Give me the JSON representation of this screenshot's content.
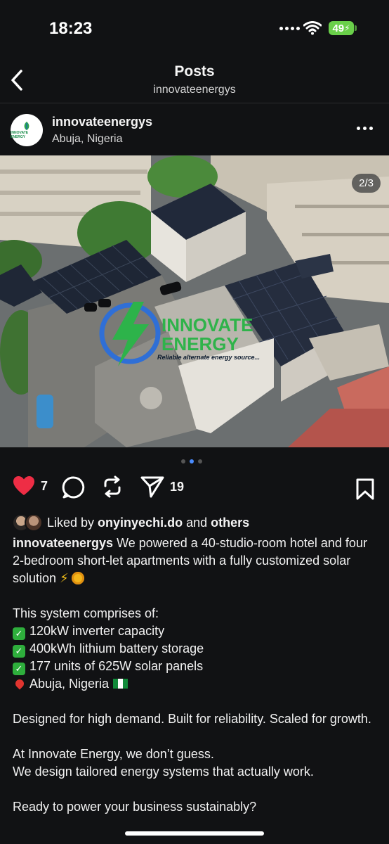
{
  "status": {
    "time": "18:23",
    "battery": "49"
  },
  "nav": {
    "title": "Posts",
    "subtitle": "innovateenergys"
  },
  "post": {
    "username": "innovateenergys",
    "location": "Abuja, Nigeria",
    "avatar_text": "INNOVATE ENERGY",
    "image_counter": "2/3",
    "image_overlay": {
      "brand_top": "INNOVATE",
      "brand_bottom": "ENERGY",
      "tagline": "Reliable alternate energy source..."
    },
    "likes": "7",
    "shares": "19",
    "liked_by_prefix": "Liked by ",
    "liked_by_user": "onyinyechi.do",
    "liked_by_and": " and ",
    "liked_by_others": "others",
    "caption": {
      "username": "innovateenergys",
      "intro": "We powered a 40-studio-room hotel and four 2-bedroom short-let apartments with a fully customized solar solution ",
      "system_heading": "This system comprises of:",
      "items": [
        "120kW inverter capacity",
        "400kWh lithium battery storage",
        "177 units of 625W solar panels"
      ],
      "place": "Abuja, Nigeria",
      "tagline": "Designed for high demand. Built for reliability. Scaled for growth.",
      "line1": "At Innovate Energy, we don’t guess.",
      "line2": "We design tailored energy systems that actually work.",
      "closing": "Ready to power your business sustainably?"
    }
  },
  "colors": {
    "background": "#111214",
    "like_red": "#ee2d45",
    "dot_active": "#4a8cff"
  },
  "icons": [
    "back-arrow-icon",
    "more-icon",
    "heart-icon",
    "comment-icon",
    "repost-icon",
    "send-icon",
    "bookmark-icon"
  ]
}
